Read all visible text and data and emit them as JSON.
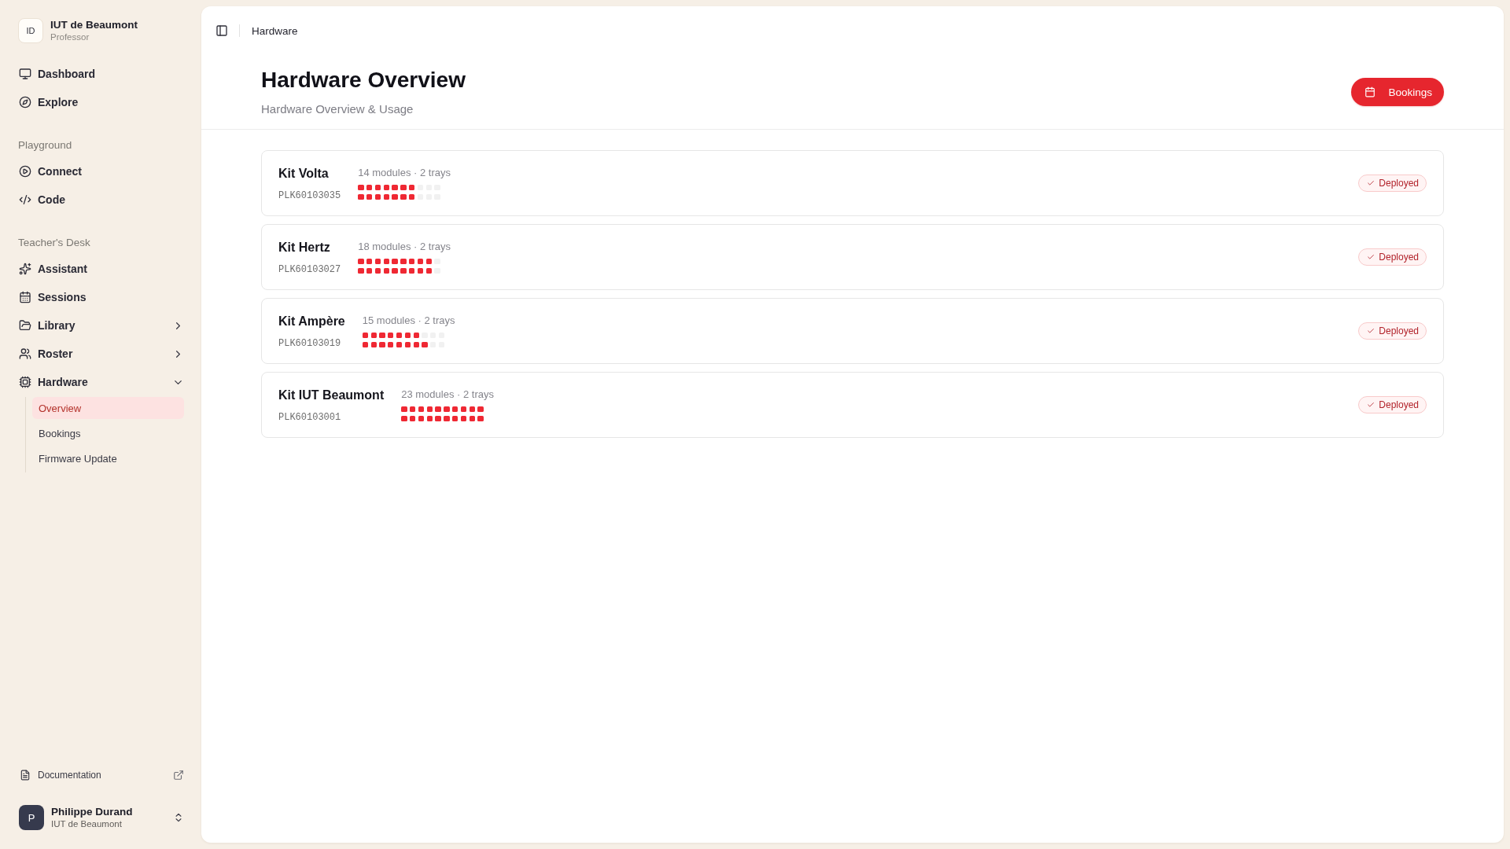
{
  "sidebar": {
    "org": {
      "initials": "ID",
      "name": "IUT de Beaumont",
      "role": "Professor"
    },
    "sections": [
      {
        "items": [
          {
            "label": "Dashboard",
            "kind": "link",
            "selected": false
          },
          {
            "label": "Explore",
            "kind": "link",
            "selected": false
          }
        ]
      },
      {
        "title": "Playground",
        "items": [
          {
            "label": "Connect",
            "kind": "link",
            "selected": false
          },
          {
            "label": "Code",
            "kind": "link",
            "selected": false
          }
        ]
      },
      {
        "title": "Teacher's Desk",
        "items": [
          {
            "label": "Assistant",
            "kind": "link",
            "selected": false
          },
          {
            "label": "Sessions",
            "kind": "link",
            "selected": false
          },
          {
            "label": "Library",
            "kind": "group",
            "expanded": false,
            "selected": false
          },
          {
            "label": "Roster",
            "kind": "group",
            "expanded": false,
            "selected": false
          },
          {
            "label": "Hardware",
            "kind": "group",
            "expanded": true,
            "selected": false,
            "children": [
              {
                "label": "Overview",
                "selected": true
              },
              {
                "label": "Bookings",
                "selected": false
              },
              {
                "label": "Firmware Update",
                "selected": false
              }
            ]
          }
        ]
      }
    ],
    "footer_link": {
      "label": "Documentation"
    },
    "user": {
      "initial": "P",
      "name": "Philippe Durand",
      "org": "IUT de Beaumont"
    }
  },
  "topbar": {
    "breadcrumb": "Hardware"
  },
  "header": {
    "title": "Hardware Overview",
    "subtitle": "Hardware Overview & Usage",
    "action": "Bookings"
  },
  "kits": [
    {
      "name": "Kit Volta",
      "serial": "PLK60103035",
      "summary": "14 modules · 2 trays",
      "trays": [
        {
          "slots": [
            {
              "filled": true
            },
            {
              "filled": true
            },
            {
              "filled": true
            },
            {
              "filled": true
            },
            {
              "filled": true
            },
            {
              "filled": true
            },
            {
              "filled": true
            },
            {
              "filled": false
            },
            {
              "filled": false
            },
            {
              "filled": false
            }
          ]
        },
        {
          "slots": [
            {
              "filled": true
            },
            {
              "filled": true
            },
            {
              "filled": true
            },
            {
              "filled": true
            },
            {
              "filled": true
            },
            {
              "filled": true
            },
            {
              "filled": true
            },
            {
              "filled": false
            },
            {
              "filled": false
            },
            {
              "filled": false
            }
          ]
        }
      ],
      "status": "Deployed"
    },
    {
      "name": "Kit Hertz",
      "serial": "PLK60103027",
      "summary": "18 modules · 2 trays",
      "trays": [
        {
          "slots": [
            {
              "filled": true
            },
            {
              "filled": true
            },
            {
              "filled": true
            },
            {
              "filled": true
            },
            {
              "filled": true
            },
            {
              "filled": true
            },
            {
              "filled": true
            },
            {
              "filled": true
            },
            {
              "filled": true
            },
            {
              "filled": false
            }
          ]
        },
        {
          "slots": [
            {
              "filled": true
            },
            {
              "filled": true
            },
            {
              "filled": true
            },
            {
              "filled": true
            },
            {
              "filled": true
            },
            {
              "filled": true
            },
            {
              "filled": true
            },
            {
              "filled": true
            },
            {
              "filled": true
            },
            {
              "filled": false
            }
          ]
        }
      ],
      "status": "Deployed"
    },
    {
      "name": "Kit Ampère",
      "serial": "PLK60103019",
      "summary": "15 modules · 2 trays",
      "trays": [
        {
          "slots": [
            {
              "filled": true
            },
            {
              "filled": true
            },
            {
              "filled": true
            },
            {
              "filled": true
            },
            {
              "filled": true
            },
            {
              "filled": true
            },
            {
              "filled": true
            },
            {
              "filled": false
            },
            {
              "filled": false
            },
            {
              "filled": false
            }
          ]
        },
        {
          "slots": [
            {
              "filled": true
            },
            {
              "filled": true
            },
            {
              "filled": true
            },
            {
              "filled": true
            },
            {
              "filled": true
            },
            {
              "filled": true
            },
            {
              "filled": true
            },
            {
              "filled": true
            },
            {
              "filled": false
            },
            {
              "filled": false
            }
          ]
        }
      ],
      "status": "Deployed"
    },
    {
      "name": "Kit IUT Beaumont",
      "serial": "PLK60103001",
      "summary": "23 modules · 2 trays",
      "trays": [
        {
          "slots": [
            {
              "filled": true
            },
            {
              "filled": true
            },
            {
              "filled": true
            },
            {
              "filled": true
            },
            {
              "filled": true
            },
            {
              "filled": true
            },
            {
              "filled": true
            },
            {
              "filled": true
            },
            {
              "filled": true
            },
            {
              "filled": true
            }
          ]
        },
        {
          "slots": [
            {
              "filled": true
            },
            {
              "filled": true
            },
            {
              "filled": true
            },
            {
              "filled": true
            },
            {
              "filled": true
            },
            {
              "filled": true
            },
            {
              "filled": true
            },
            {
              "filled": true
            },
            {
              "filled": true
            },
            {
              "filled": true
            }
          ]
        }
      ],
      "status": "Deployed"
    }
  ]
}
